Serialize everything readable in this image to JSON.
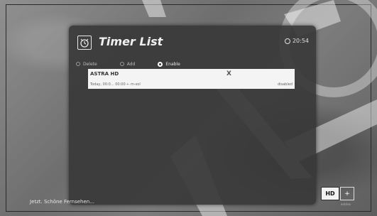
{
  "panel": {
    "title": "Timer List",
    "clock": "20:54",
    "icons": {
      "title": "alarm-clock-icon",
      "clock": "clock-icon"
    }
  },
  "toolbar": {
    "buttons": [
      {
        "label": "Delete",
        "active": false
      },
      {
        "label": "Add",
        "active": false
      },
      {
        "label": "Enable",
        "active": true
      }
    ]
  },
  "timers": [
    {
      "channel": "ASTRA HD",
      "mark": "X",
      "time": "Today, 00:0... 00:00 ← m-sol",
      "status": "disabled"
    }
  ],
  "bottom": {
    "text": "Jetzt. Schöne Fernsehen..."
  },
  "badges": {
    "hd": "HD",
    "plus": "+",
    "plus_sub": "entries"
  },
  "colors": {
    "panel": "#383838",
    "selected_row": "#f4f4f4",
    "text": "#f0f0f0"
  }
}
